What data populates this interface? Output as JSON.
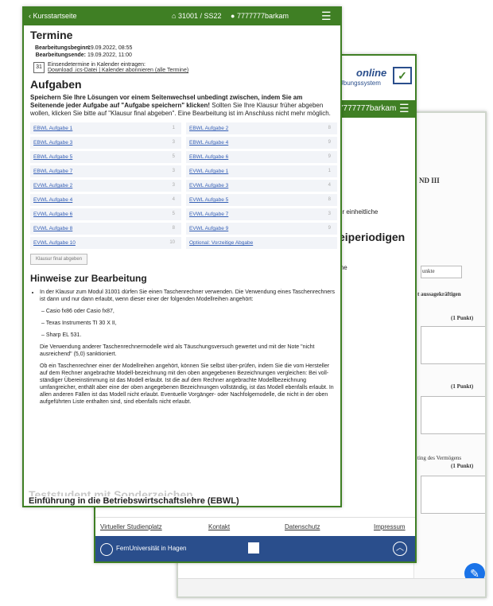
{
  "front": {
    "header": {
      "back_label": "Kursstartseite",
      "course": "31001 / SS22",
      "user": "7777777barkam",
      "menu_icon": "hamburger-icon"
    },
    "termine": {
      "title": "Termine",
      "start_label": "Bearbeitungsbeginn:",
      "start_value": "19.09.2022, 08:55",
      "end_label": "Bearbeitungsende:",
      "end_value": "19.09.2022, 11:00",
      "calendar_intro": "Einsendetermine in Kalender eintragen:",
      "calendar_links": "Download .ics-Datei | Kalender abonnieren (alle Termine)"
    },
    "aufgaben": {
      "title": "Aufgaben",
      "warning_bold": "Speichern Sie Ihre Lösungen vor einem Seitenwechsel unbedingt zwischen, indem Sie am Seitenende jeder Aufgabe auf \"Aufgabe speichern\" klicken!",
      "warning_rest": " Sollten Sie Ihre Klausur früher abgeben wollen, klicken Sie bitte auf \"Klausur final abgeben\". Eine Bearbeitung ist im Anschluss nicht mehr möglich.",
      "tasks": [
        {
          "name": "EBWL Aufgabe 1",
          "n": "1"
        },
        {
          "name": "EBWL Aufgabe 2",
          "n": "8"
        },
        {
          "name": "EBWL Aufgabe 3",
          "n": "3"
        },
        {
          "name": "EBWL Aufgabe 4",
          "n": "9"
        },
        {
          "name": "EBWL Aufgabe 5",
          "n": "5"
        },
        {
          "name": "EBWL Aufgabe 6",
          "n": "9"
        },
        {
          "name": "EBWL Aufgabe 7",
          "n": "3"
        },
        {
          "name": "EVWL Aufgabe 1",
          "n": "1"
        },
        {
          "name": "EVWL Aufgabe 2",
          "n": "3"
        },
        {
          "name": "EVWL Aufgabe 3",
          "n": "4"
        },
        {
          "name": "EVWL Aufgabe 4",
          "n": "4"
        },
        {
          "name": "EVWL Aufgabe 5",
          "n": "8"
        },
        {
          "name": "EVWL Aufgabe 6",
          "n": "5"
        },
        {
          "name": "EVWL Aufgabe 7",
          "n": "3"
        },
        {
          "name": "EVWL Aufgabe 8",
          "n": "8"
        },
        {
          "name": "EVWL Aufgabe 9",
          "n": "9"
        },
        {
          "name": "EVWL Aufgabe 10",
          "n": "10"
        },
        {
          "name": "Optional: Vorzeitige Abgabe",
          "n": ""
        }
      ],
      "final_button": "Klausur final abgeben"
    },
    "hinweise": {
      "title": "Hinweise zur Bearbeitung",
      "intro": "In der Klausur zum Modul 31001 dürfen Sie einen Taschenrechner verwenden. Die Verwendung eines Taschenrechners ist dann und nur dann erlaubt, wenn dieser einer der folgenden Modellreihen angehört:",
      "models": [
        "– Casio fx86 oder Casio fx87,",
        "– Texas Instruments TI 30 X II,",
        "– Sharp EL 531."
      ],
      "para1": "Die Verwendung anderer Taschenrechnermodelle wird als Täuschungsversuch gewertet und mit der Note \"nicht ausreichend\" (5,0) sanktioniert.",
      "para2": "Ob ein Taschenrechner einer der Modellreihen angehört, können Sie selbst über-prüfen, indem Sie die vom Hersteller auf dem Rechner angebrachte Modell-bezeichnung mit den oben angegebenen Bezeichnungen vergleichen: Bei voll-ständiger Übereinstimmung ist das Modell erlaubt. Ist die auf dem Rechner angebrachte Modellbezeichnung umfangreicher, enthält aber eine der oben angegebenen Bezeichnungen vollständig, ist das Modell ebenfalls erlaubt. In allen anderen Fällen ist das Modell nicht erlaubt. Eventuelle Vorgänger- oder Nachfolgemodelle, die nicht in der oben aufgeführten Liste enthalten sind, sind ebenfalls nicht erlaubt."
    },
    "watermark": "Teststudent mit Sonderzeichen",
    "bottom_title": "Einführung in die Betriebswirtschaftslehre (EBWL)"
  },
  "mid": {
    "logo_text": "online",
    "logo_sub": "Übungssystem",
    "user": "7777777barkam",
    "frag1": "er einheitliche",
    "frag2": "eiperiodigen",
    "frag3": "ine",
    "footer_links": [
      "Virtueller Studienplatz",
      "Kontakt",
      "Datenschutz",
      "Impressum"
    ],
    "university": "FernUniversität in Hagen"
  },
  "back": {
    "heading": "ND III",
    "label_punkte": "unkte",
    "note1": "t aussagekräftigen",
    "points1": "(1 Punkt)",
    "points2": "(1 Punkt)",
    "note2": "ting des Vermögens",
    "points3": "(1 Punkt)"
  }
}
